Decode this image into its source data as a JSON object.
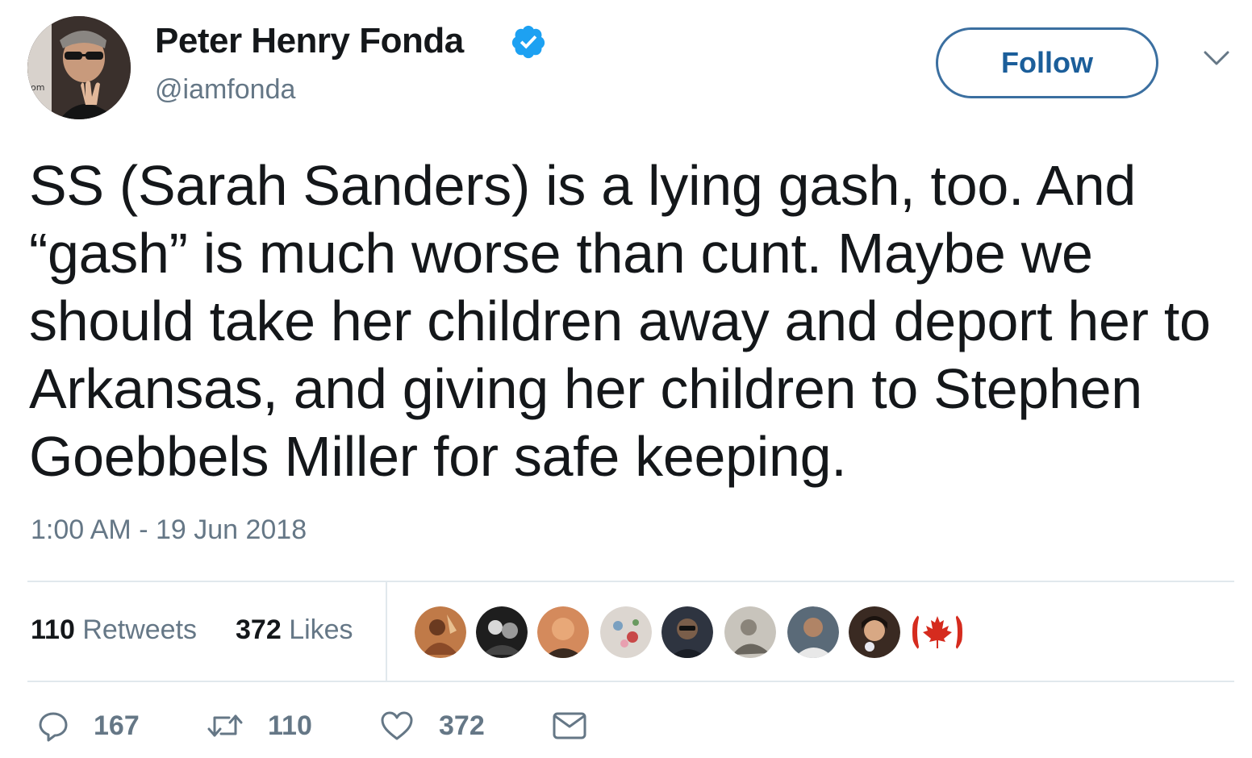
{
  "author": {
    "name": "Peter Henry Fonda",
    "handle": "@iamfonda",
    "verified": true,
    "verified_color": "#1da1f2"
  },
  "header": {
    "follow_label": "Follow",
    "menu_icon": "chevron-down-icon"
  },
  "tweet": {
    "text": "SS (Sarah Sanders) is a lying gash, too. And “gash” is much worse than cunt. Maybe we should take her children away and deport her to Arkansas, and giving her children to Stephen Goebbels Miller for safe keeping.",
    "timestamp": "1:00 AM - 19 Jun 2018"
  },
  "stats": {
    "retweets_count": "110",
    "retweets_label": "Retweets",
    "likes_count": "372",
    "likes_label": "Likes"
  },
  "likers": [
    {
      "icon": "avatar",
      "color": "#a0643c"
    },
    {
      "icon": "avatar",
      "color": "#2a2a2a"
    },
    {
      "icon": "avatar",
      "color": "#c8825a"
    },
    {
      "icon": "avatar",
      "color": "#d9d0c8"
    },
    {
      "icon": "avatar",
      "color": "#3a3f4a"
    },
    {
      "icon": "avatar",
      "color": "#b8b4ac"
    },
    {
      "icon": "avatar",
      "color": "#5a6470"
    },
    {
      "icon": "avatar",
      "color": "#4a3328"
    },
    {
      "icon": "canada-flag-icon",
      "color": "#d52b1e"
    }
  ],
  "actions": {
    "reply_count": "167",
    "retweet_count": "110",
    "like_count": "372"
  },
  "colors": {
    "text": "#14171a",
    "secondary": "#657786",
    "divider": "#e1e8ed",
    "follow_border": "#3b6fa0"
  }
}
